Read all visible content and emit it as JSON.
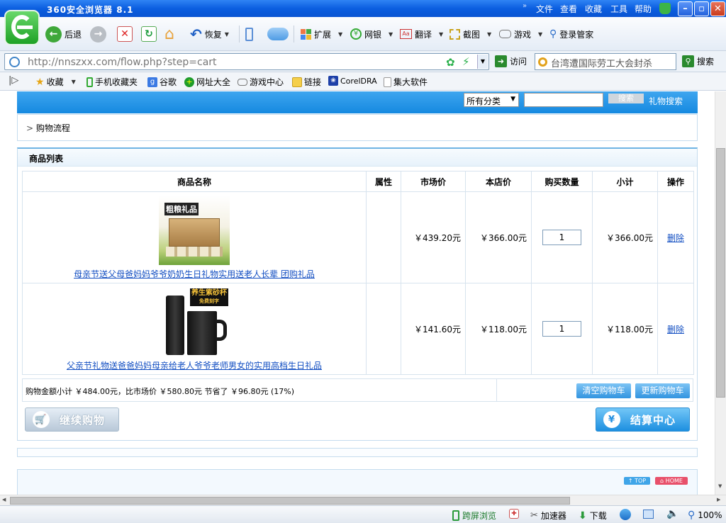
{
  "window": {
    "title": "360安全浏览器 8.1",
    "menu": [
      "文件",
      "查看",
      "收藏",
      "工具",
      "帮助"
    ]
  },
  "toolbar": {
    "back": "后退",
    "restore": "恢复",
    "extend": "扩展",
    "netbank": "网银",
    "translate": "翻译",
    "screenshot": "截图",
    "games": "游戏",
    "login": "登录管家"
  },
  "address": {
    "url": "http://nnszxx.com/flow.php?step=cart",
    "go_label": "访问",
    "search_text": "台湾遭国际劳工大会封杀",
    "search_button": "搜索"
  },
  "favorites": [
    "收藏",
    "手机收藏夹",
    "谷歌",
    "网址大全",
    "游戏中心",
    "链接",
    "CorelDRA",
    "集大软件"
  ],
  "site_header": {
    "category_select": "所有分类",
    "search_button": "搜索",
    "gift_search": "礼物搜索"
  },
  "breadcrumb": "购物流程",
  "cart": {
    "title": "商品列表",
    "columns": [
      "商品名称",
      "属性",
      "市场价",
      "本店价",
      "购买数量",
      "小计",
      "操作"
    ],
    "items": [
      {
        "name": "母亲节送父母爸妈妈爷爷奶奶生日礼物实用送老人长辈 团购礼品",
        "img_text": "粗粮礼品",
        "attr": "",
        "market_price": "￥439.20元",
        "shop_price": "￥366.00元",
        "qty": "1",
        "subtotal": "￥366.00元",
        "action": "删除"
      },
      {
        "name": "父亲节礼物送爸爸妈妈母亲给老人爷爷老师男女的实用高档生日礼品",
        "img_text": "养生紫砂杯",
        "img_subtext": "免费刻字",
        "attr": "",
        "market_price": "￥141.60元",
        "shop_price": "￥118.00元",
        "qty": "1",
        "subtotal": "￥118.00元",
        "action": "删除"
      }
    ],
    "summary": "购物金额小计 ￥484.00元，比市场价 ￥580.80元 节省了 ￥96.80元 (17%)",
    "clear_button": "清空购物车",
    "update_button": "更新购物车",
    "continue_button": "继续购物",
    "checkout_button": "结算中心"
  },
  "footer": {
    "top_tag": "TOP",
    "home_tag": "HOME"
  },
  "statusbar": {
    "cross_screen": "跨屏浏览",
    "accelerator": "加速器",
    "download": "下载",
    "zoom": "100%"
  }
}
